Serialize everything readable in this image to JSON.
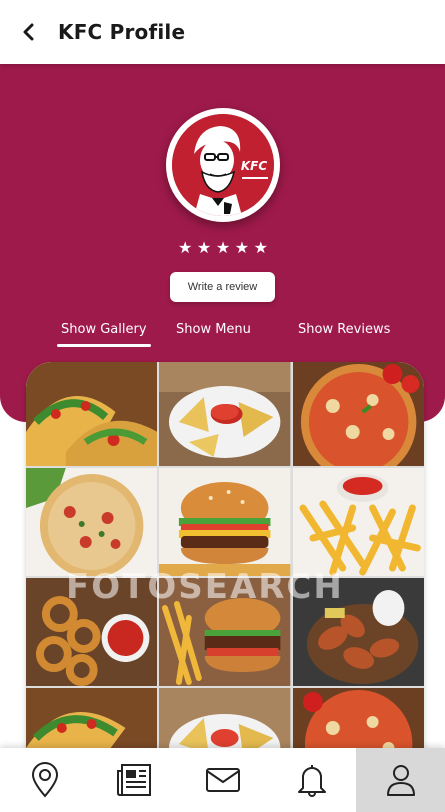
{
  "header": {
    "title": "KFC Profile",
    "back_icon": "back-arrow-icon"
  },
  "profile": {
    "logo_text": "KFC",
    "rating_stars": 5,
    "review_button": "Write a review",
    "brand_color": "#9e1a4a"
  },
  "tabs": [
    {
      "label": "Show Gallery",
      "active": true
    },
    {
      "label": "Show Menu",
      "active": false
    },
    {
      "label": "Show Reviews",
      "active": false
    }
  ],
  "gallery": {
    "watermark": "FOTOSEARCH",
    "items": [
      "tacos",
      "nachos",
      "pizza",
      "pizza",
      "burger",
      "fries",
      "onion-rings",
      "burger-fries",
      "chicken-wings",
      "tacos",
      "nachos",
      "pizza"
    ]
  },
  "bottom_nav": [
    {
      "icon": "location-pin-icon",
      "active": false
    },
    {
      "icon": "news-icon",
      "active": false
    },
    {
      "icon": "mail-icon",
      "active": false
    },
    {
      "icon": "bell-icon",
      "active": false
    },
    {
      "icon": "user-icon",
      "active": true
    }
  ]
}
